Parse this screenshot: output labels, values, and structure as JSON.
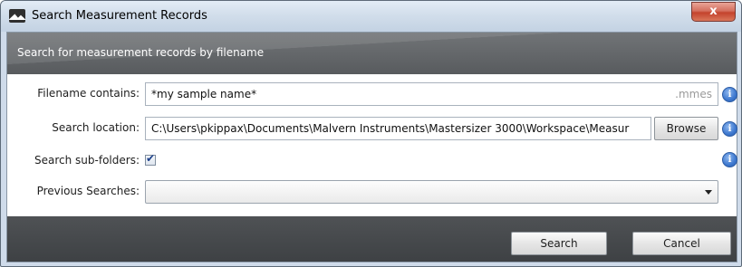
{
  "window": {
    "title": "Search Measurement Records",
    "app_icon": "mountain-icon",
    "close_label": "x"
  },
  "header": {
    "text": "Search for measurement records by filename"
  },
  "form": {
    "filename": {
      "label": "Filename contains:",
      "value": "*my sample name*",
      "suffix": ".mmes"
    },
    "location": {
      "label": "Search location:",
      "value": "C:\\Users\\pkippax\\Documents\\Malvern Instruments\\Mastersizer 3000\\Workspace\\Measur",
      "browse_label": "Browse"
    },
    "subfolders": {
      "label": "Search sub-folders:",
      "checked": true
    },
    "previous": {
      "label": "Previous Searches:",
      "selected": ""
    },
    "info_glyph": "i"
  },
  "footer": {
    "search_label": "Search",
    "cancel_label": "Cancel"
  },
  "colors": {
    "header_band": "#5f6265",
    "footer_band": "#45484b",
    "info_icon": "#3d78cf",
    "close_button": "#c4422c"
  }
}
